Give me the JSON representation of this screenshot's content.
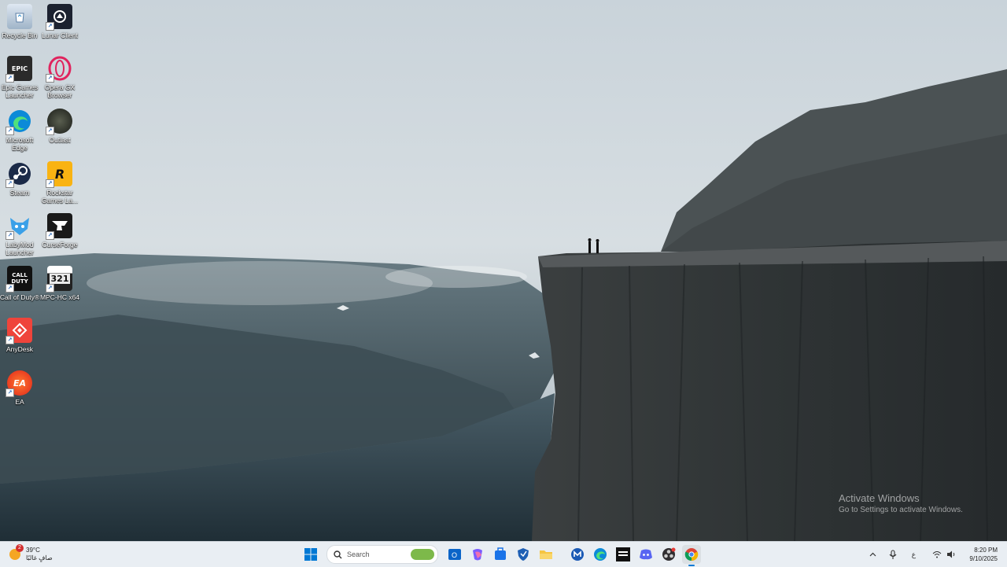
{
  "desktop": {
    "icons": [
      {
        "label": "Recycle Bin",
        "icon": "recycle-bin-icon"
      },
      {
        "label": "Lunar Client",
        "icon": "lunar-client-icon"
      },
      {
        "label": "Epic Games Launcher",
        "icon": "epic-games-icon",
        "glyph": "EPIC"
      },
      {
        "label": "Opera GX Browser",
        "icon": "opera-gx-icon"
      },
      {
        "label": "Microsoft Edge",
        "icon": "edge-icon"
      },
      {
        "label": "Outlast",
        "icon": "outlast-icon"
      },
      {
        "label": "Steam",
        "icon": "steam-icon"
      },
      {
        "label": "Rockstar Games La...",
        "icon": "rockstar-icon",
        "glyph": "R"
      },
      {
        "label": "LabyMod Launcher",
        "icon": "labymod-icon"
      },
      {
        "label": "CurseForge",
        "icon": "curseforge-icon"
      },
      {
        "label": "Call of Duty®",
        "icon": "call-of-duty-icon",
        "glyph": "CALL DUTY"
      },
      {
        "label": "MPC-HC x64",
        "icon": "mpc-hc-icon",
        "glyph": "321"
      },
      {
        "label": "AnyDesk",
        "icon": "anydesk-icon"
      },
      {
        "label": "EA",
        "icon": "ea-icon",
        "glyph": "EA"
      }
    ]
  },
  "watermark": {
    "title": "Activate Windows",
    "subtitle": "Go to Settings to activate Windows."
  },
  "taskbar": {
    "weather": {
      "temp": "39°C",
      "condition": "صافٍ غالبًا",
      "badge": "2"
    },
    "search_placeholder": "Search",
    "pinned": [
      "start-icon",
      "outlook-icon",
      "copilot-icon",
      "store-icon",
      "defender-icon",
      "file-explorer-icon",
      "malwarebytes-icon",
      "edge-icon",
      "call-of-duty-icon",
      "discord-icon",
      "obs-icon",
      "chrome-icon"
    ],
    "tray": {
      "language": "ع",
      "time": "8:20 PM",
      "date": "9/10/2025"
    }
  },
  "colors": {
    "taskbar_bg": "#e9eef3",
    "accent": "#0078d4"
  }
}
